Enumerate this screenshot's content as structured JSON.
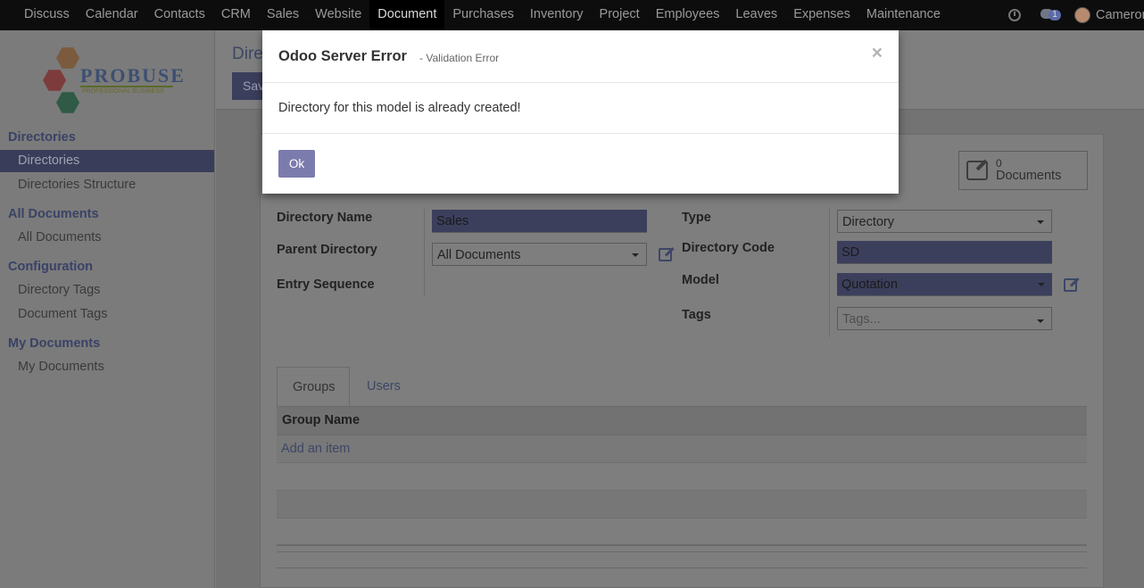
{
  "navbar": {
    "menu": [
      "Discuss",
      "Calendar",
      "Contacts",
      "CRM",
      "Sales",
      "Website",
      "Document",
      "Purchases",
      "Inventory",
      "Project",
      "Employees",
      "Leaves",
      "Expenses",
      "Maintenance"
    ],
    "active": "Document",
    "chat_badge": "1",
    "user_name": "Cameron",
    "icons": [
      "clock-icon",
      "chat-icon",
      "avatar"
    ]
  },
  "sidebar": {
    "logo": {
      "word": "PROBUSE",
      "tagline": "PROFESSIONAL BUSINESS"
    },
    "sections": [
      {
        "title": "Directories",
        "items": [
          "Directories",
          "Directories Structure"
        ]
      },
      {
        "title": "All Documents",
        "items": [
          "All Documents"
        ]
      },
      {
        "title": "Configuration",
        "items": [
          "Directory Tags",
          "Document Tags"
        ]
      },
      {
        "title": "My Documents",
        "items": [
          "My Documents"
        ]
      }
    ],
    "active_item": "Directories"
  },
  "control_panel": {
    "breadcrumb": "Directories",
    "save_label": "Save"
  },
  "form": {
    "smart_button": {
      "count": "0",
      "label": "Documents"
    },
    "labels": {
      "directory_name": "Directory Name",
      "parent_directory": "Parent Directory",
      "entry_sequence": "Entry Sequence",
      "type": "Type",
      "directory_code": "Directory Code",
      "model": "Model",
      "tags": "Tags"
    },
    "values": {
      "directory_name": "Sales",
      "parent_directory": "All Documents",
      "type": "Directory",
      "directory_code": "SD",
      "model": "Quotation",
      "tags_placeholder": "Tags..."
    },
    "tabs": [
      "Groups",
      "Users"
    ],
    "active_tab": "Groups",
    "table": {
      "header": "Group Name",
      "add_item": "Add an item"
    }
  },
  "modal": {
    "title": "Odoo Server Error",
    "subtitle": "- Validation Error",
    "close": "×",
    "message": "Directory for this model is already created!",
    "ok_label": "Ok"
  },
  "colors": {
    "primary": "#7c7bad",
    "navbar": "#0d0d0d",
    "overlay": "#7f7f7f"
  }
}
